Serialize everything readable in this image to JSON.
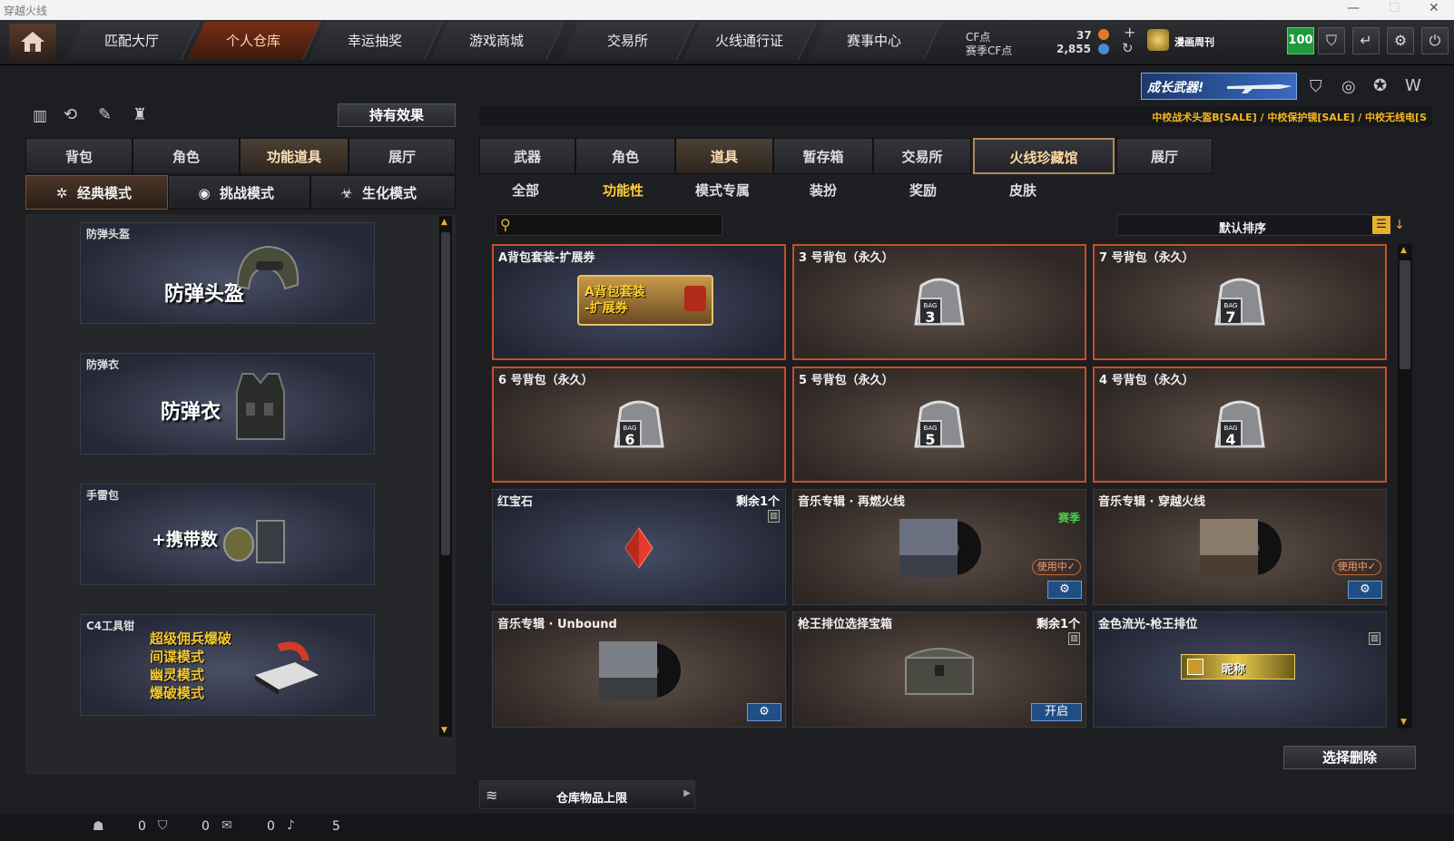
{
  "window": {
    "title": "穿越火线",
    "min": "—",
    "max": "☐",
    "close": "✕"
  },
  "nav": {
    "tabs": [
      "匹配大厅",
      "个人仓库",
      "幸运抽奖",
      "游戏商城",
      "交易所",
      "火线通行证",
      "赛事中心"
    ],
    "cf_label": "CF点",
    "cf_value": "37",
    "season_label": "赛季CF点",
    "season_value": "2,855",
    "plus": "+",
    "user_name": "漫画周刊",
    "level": "100"
  },
  "banner": {
    "growth_text": "成长武器!",
    "marquee": "中校战术头盔B[SALE] / 中校保护镜[SALE] / 中校无线电[S"
  },
  "left": {
    "effects_button": "持有效果",
    "tabs": [
      "背包",
      "角色",
      "功能道具",
      "展厅"
    ],
    "modes": [
      "经典模式",
      "挑战模式",
      "生化模式"
    ],
    "cards": [
      {
        "label": "防弹头盔",
        "big": "防弹头盔"
      },
      {
        "label": "防弹衣",
        "big": "防弹衣"
      },
      {
        "label": "手雷包",
        "big": "+携带数"
      },
      {
        "label": "C4工具钳",
        "lines": [
          "超级佣兵爆破",
          "间谍模式",
          "幽灵模式",
          "爆破模式"
        ]
      }
    ]
  },
  "right": {
    "tabs": [
      "武器",
      "角色",
      "道具",
      "暂存箱",
      "交易所",
      "火线珍藏馆",
      "展厅"
    ],
    "subtabs": [
      "全部",
      "功能性",
      "模式专属",
      "装扮",
      "奖励",
      "皮肤"
    ],
    "sort_label": "默认排序",
    "items": [
      {
        "name": "A背包套装-扩展券",
        "art": "A背包套装\n-扩展券"
      },
      {
        "name": "3 号背包（永久）",
        "bag": "3"
      },
      {
        "name": "7 号背包（永久）",
        "bag": "7"
      },
      {
        "name": "6 号背包（永久）",
        "bag": "6"
      },
      {
        "name": "5 号背包（永久）",
        "bag": "5"
      },
      {
        "name": "4 号背包（永久）",
        "bag": "4"
      },
      {
        "name": "红宝石",
        "remain": "剩余1个"
      },
      {
        "name": "音乐专辑 · 再燃火线",
        "tag": "赛季",
        "inuse": "使用中✓"
      },
      {
        "name": "音乐专辑 · 穿越火线",
        "inuse": "使用中✓"
      },
      {
        "name": "音乐专辑 · Unbound"
      },
      {
        "name": "枪王排位选择宝箱",
        "remain": "剩余1个",
        "open": "开启"
      },
      {
        "name": "金色流光-枪王排位",
        "nickname": "昵称"
      }
    ],
    "bag_label": "BAG",
    "delete_button": "选择删除",
    "storage_limit": "仓库物品上限"
  },
  "status": {
    "a": "0",
    "b": "0",
    "c": "0",
    "d": "5"
  }
}
